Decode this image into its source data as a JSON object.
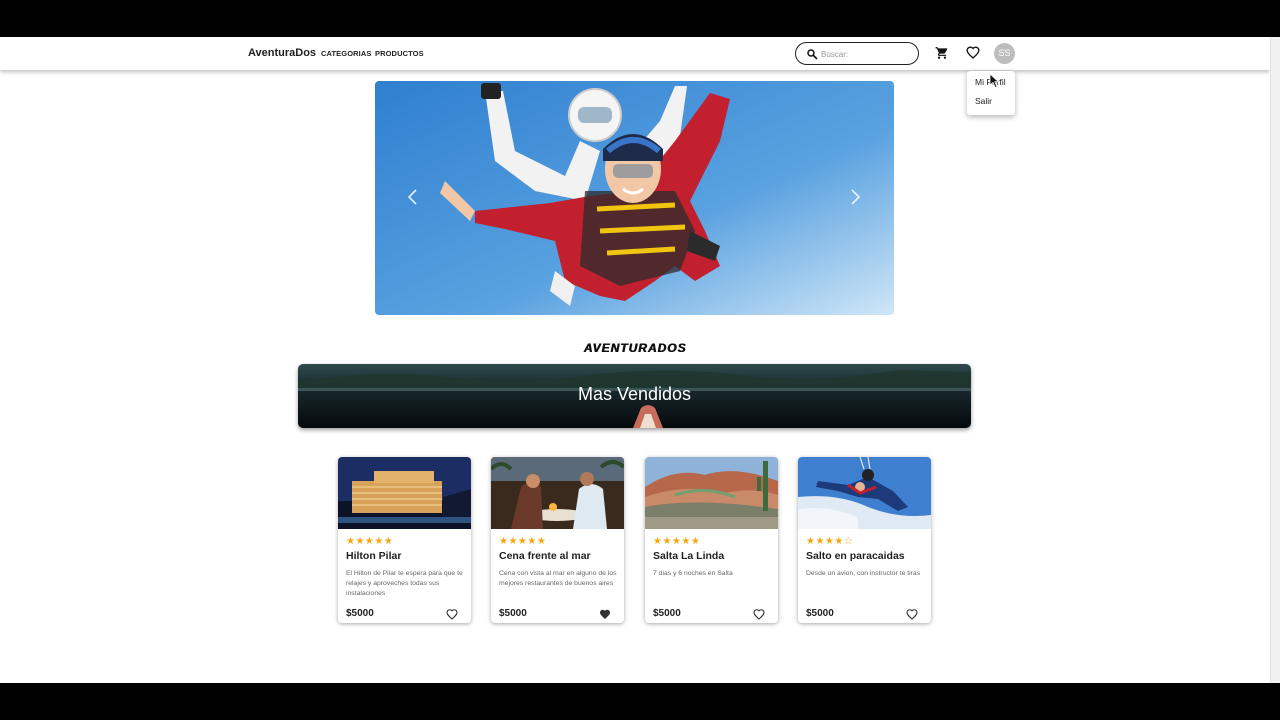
{
  "navbar": {
    "brand": "AventuraDos",
    "links": [
      "CATEGORIAS",
      "PRODUCTOS"
    ],
    "search_placeholder": "Buscar:",
    "avatar_initials": "SS"
  },
  "user_menu": {
    "items": [
      "Mi Perfil",
      "Salir"
    ]
  },
  "section_title": "AVENTURADOS",
  "banner_title": "Mas Vendidos",
  "products": [
    {
      "title": "Hilton Pilar",
      "stars": "★★★★★",
      "description": "El Hilton de Pilar te espera para que te relajes y aproveches todas sus instalaciones",
      "price": "$5000",
      "favorite": false
    },
    {
      "title": "Cena frente al mar",
      "stars": "★★★★★",
      "description": "Cena con vista al mar en alguno de los mejores restaurantes de buenos aires",
      "price": "$5000",
      "favorite": true
    },
    {
      "title": "Salta La Linda",
      "stars": "★★★★★",
      "description": "7 dias y 6 noches en Salta",
      "price": "$5000",
      "favorite": false
    },
    {
      "title": "Salto en paracaidas",
      "stars": "★★★★☆",
      "description": "Desde un avion, con instructor te tiras",
      "price": "$5000",
      "favorite": false
    }
  ],
  "colors": {
    "star": "#f3a712",
    "accent_dark": "#222222",
    "sky": "#5aa2e0"
  }
}
